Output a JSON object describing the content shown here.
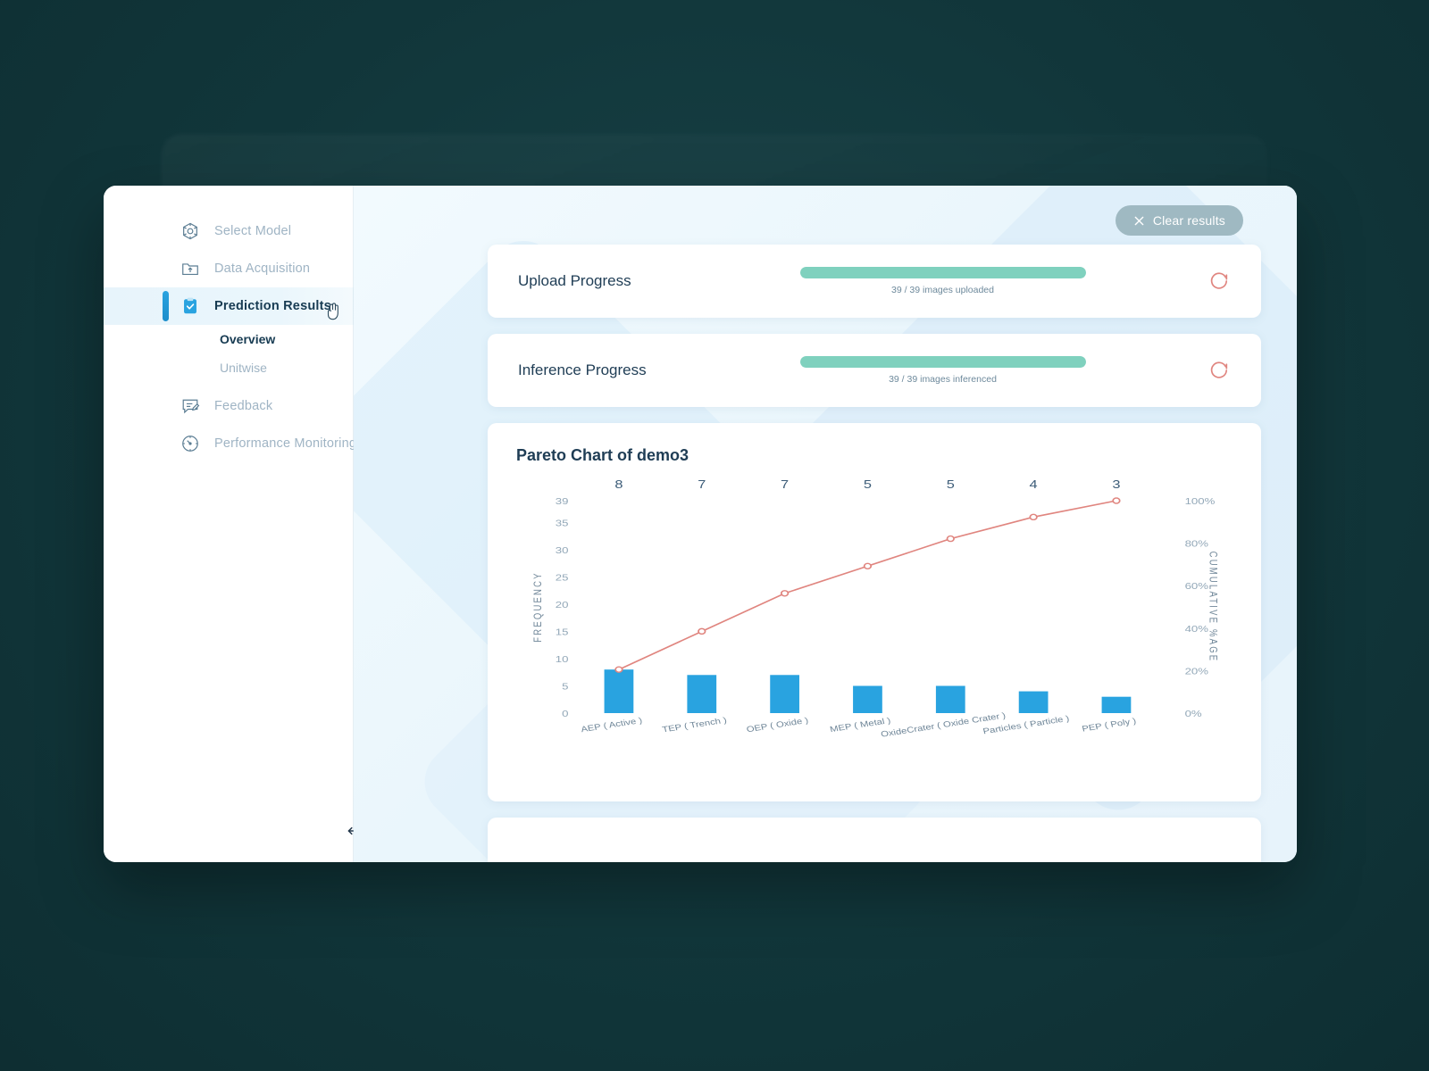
{
  "window": {
    "collapse_icon": "collapse-sidebar-icon"
  },
  "sidebar": {
    "items": [
      {
        "label": "Select Model",
        "icon": "model-cube-icon",
        "active": false
      },
      {
        "label": "Data Acquisition",
        "icon": "folder-upload-icon",
        "active": false
      },
      {
        "label": "Prediction Results",
        "icon": "clipboard-check-icon",
        "active": true
      },
      {
        "label": "Feedback",
        "icon": "message-edit-icon",
        "active": false
      },
      {
        "label": "Performance Monitoring",
        "icon": "gauge-icon",
        "active": false
      }
    ],
    "sub_items": [
      {
        "label": "Overview",
        "current": true
      },
      {
        "label": "Unitwise",
        "current": false
      }
    ]
  },
  "topbar": {
    "clear_results_label": "Clear results",
    "clear_results_icon": "close-x-icon"
  },
  "upload_card": {
    "title": "Upload Progress",
    "caption": "39 / 39 images uploaded",
    "percent": 100,
    "refresh_icon": "refresh-spinner-icon"
  },
  "inference_card": {
    "title": "Inference Progress",
    "caption": "39 / 39 images inferenced",
    "percent": 100,
    "refresh_icon": "refresh-spinner-icon"
  },
  "colors": {
    "bar": "#29a3e0",
    "line": "#e0857f",
    "progress_fill": "#7fd1be",
    "accent_button": "#9fb9c2",
    "text_dark": "#1f3d55",
    "text_muted": "#9fb4c4"
  },
  "chart_data": {
    "type": "bar",
    "title": "Pareto Chart of demo3",
    "xlabel": "",
    "ylabel": "FREQUENCY",
    "y2label": "CUMULATIVE %AGE",
    "grid": false,
    "legend": "none",
    "categories": [
      "AEP ( Active )",
      "TEP ( Trench )",
      "OEP ( Oxide )",
      "MEP ( Metal )",
      "OxideCrater ( Oxide Crater )",
      "Particles ( Particle )",
      "PEP ( Poly )"
    ],
    "values": [
      8,
      7,
      7,
      5,
      5,
      4,
      3
    ],
    "bar_labels": [
      "8",
      "7",
      "7",
      "5",
      "5",
      "4",
      "3"
    ],
    "ylim": [
      0,
      39
    ],
    "yticks": [
      "39",
      "35",
      "30",
      "25",
      "20",
      "15",
      "10",
      "5",
      "0"
    ],
    "ytick_values": [
      39,
      35,
      30,
      25,
      20,
      15,
      10,
      5,
      0
    ],
    "y2lim": [
      0,
      100
    ],
    "y2ticks": [
      "100%",
      "80%",
      "60%",
      "40%",
      "20%",
      "0%"
    ],
    "y2tick_values": [
      100,
      80,
      60,
      40,
      20,
      0
    ],
    "series": [
      {
        "name": "Frequency",
        "type": "bar",
        "values": [
          8,
          7,
          7,
          5,
          5,
          4,
          3
        ]
      },
      {
        "name": "Cumulative %",
        "type": "line",
        "values": [
          20.5,
          38.5,
          56.4,
          69.2,
          82.1,
          92.3,
          100.0
        ]
      }
    ],
    "total": 39
  }
}
